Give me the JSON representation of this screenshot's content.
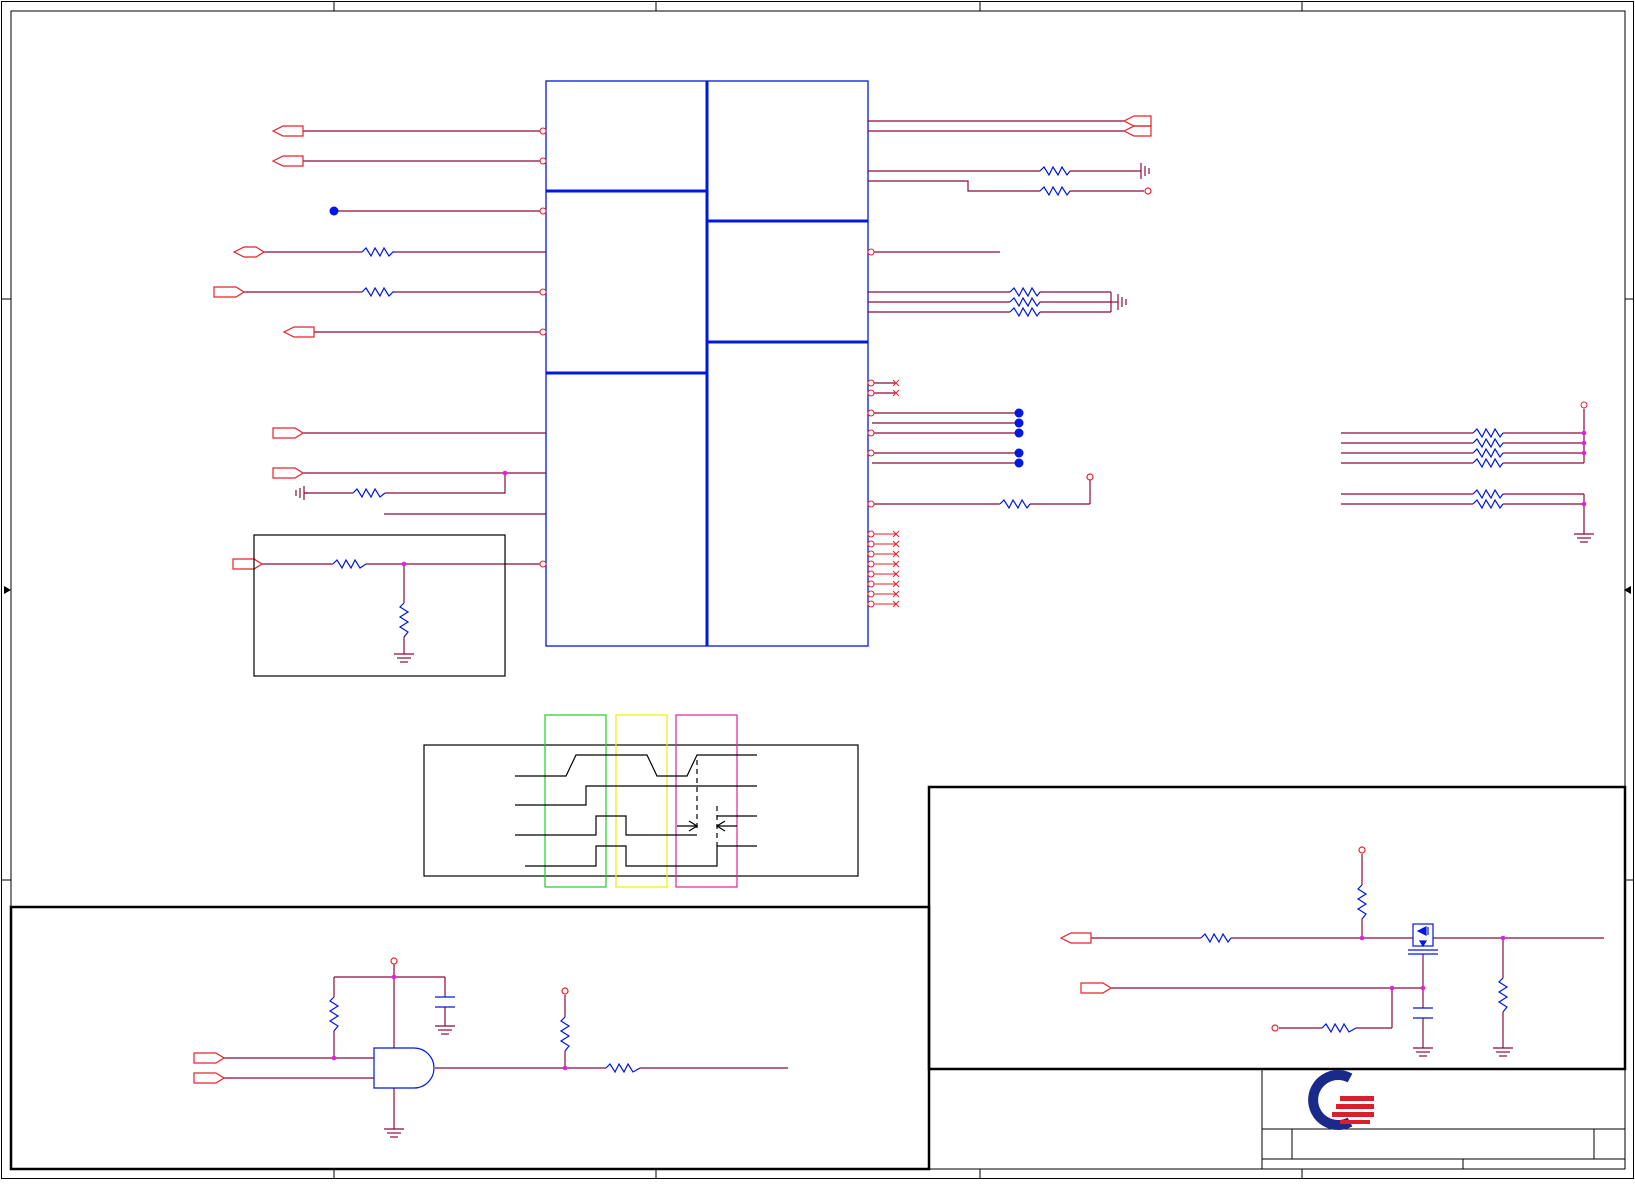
{
  "document": {
    "kind": "schematic-sheet",
    "text_labels": [],
    "colors": {
      "frame": "#000000",
      "wire": "#8b0a3a",
      "pin": "#e8202a",
      "component": "#0018e0",
      "junction": "#e020e0",
      "timing_window_1": "#22cc22",
      "timing_window_2": "#eeee00",
      "timing_window_3": "#e020a0",
      "logo_blue": "#1a2a8a",
      "logo_red": "#d8202a"
    }
  },
  "logo": {
    "icon": "company-logo-icon"
  }
}
